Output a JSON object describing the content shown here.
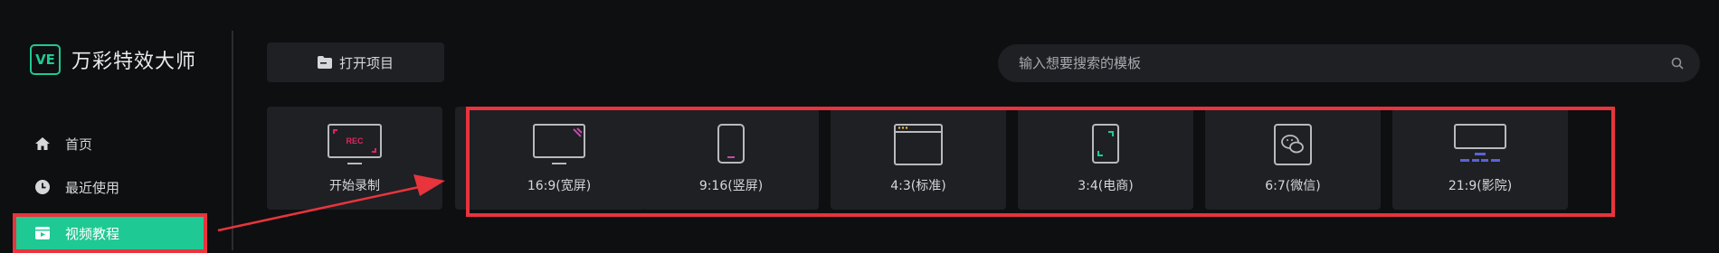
{
  "app": {
    "logo_mark": "VE",
    "name": "万彩特效大师"
  },
  "sidebar": {
    "items": [
      {
        "label": "首页",
        "icon": "home-icon"
      },
      {
        "label": "最近使用",
        "icon": "clock-icon"
      },
      {
        "label": "视频教程",
        "icon": "video-tutorial-icon",
        "active": true
      }
    ]
  },
  "toolbar": {
    "open_project_label": "打开项目"
  },
  "search": {
    "placeholder": "输入想要搜索的模板"
  },
  "record_card": {
    "label": "开始录制",
    "badge": "REC"
  },
  "ratio_cards": [
    {
      "label": "16:9(宽屏)",
      "icon": "widescreen-icon"
    },
    {
      "label": "9:16(竖屏)",
      "icon": "portrait-phone-icon"
    },
    {
      "label": "4:3(标准)",
      "icon": "standard-window-icon"
    },
    {
      "label": "3:4(电商)",
      "icon": "ecommerce-phone-icon"
    },
    {
      "label": "6:7(微信)",
      "icon": "wechat-icon"
    },
    {
      "label": "21:9(影院)",
      "icon": "cinema-icon"
    }
  ],
  "colors": {
    "accent": "#1fc994",
    "annotation_red": "#e8343d",
    "panel": "#1e2024",
    "background": "#0e0f11"
  }
}
